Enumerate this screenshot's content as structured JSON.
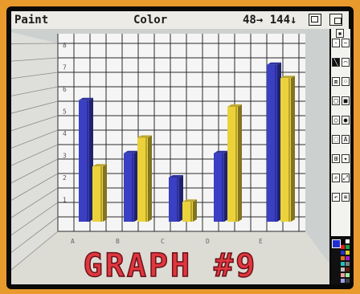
{
  "menubar": {
    "paint_label": "Paint",
    "color_label": "Color",
    "x_coord": "48",
    "x_arrow": "→",
    "y_coord": "144",
    "y_arrow": "↓"
  },
  "chart_data": {
    "type": "bar",
    "title": "GRAPH #9",
    "categories": [
      "A",
      "B",
      "C",
      "D",
      "E"
    ],
    "y_tick_labels": [
      "1",
      "2",
      "3",
      "4",
      "5",
      "6",
      "7",
      "8"
    ],
    "series": [
      {
        "color": "#3a3fc4",
        "values": [
          5.5,
          3.1,
          2.0,
          3.1,
          7.1
        ]
      },
      {
        "color": "#ecd23a",
        "values": [
          2.5,
          3.8,
          0.9,
          5.2,
          6.5
        ]
      }
    ],
    "ylim": [
      0,
      8
    ],
    "grid": true
  },
  "colors": {
    "title_fill": "#e0373f",
    "title_outline": "#6a1018",
    "floor": "#dcdcd4",
    "grid_back": "#f5f5f5"
  },
  "tools": [
    {
      "name": "dotted-freehand",
      "glyph": "·"
    },
    {
      "name": "continuous-freehand",
      "glyph": "~"
    },
    {
      "name": "straight-line",
      "glyph": "╲"
    },
    {
      "name": "curve",
      "glyph": "⌒"
    },
    {
      "name": "fill",
      "glyph": "⧈"
    },
    {
      "name": "airbrush",
      "glyph": "⁘"
    },
    {
      "name": "rectangle",
      "glyph": "□"
    },
    {
      "name": "filled-rectangle",
      "glyph": "■"
    },
    {
      "name": "circle",
      "glyph": "○"
    },
    {
      "name": "filled-circle",
      "glyph": "●"
    },
    {
      "name": "brush-select",
      "glyph": "⬚"
    },
    {
      "name": "text",
      "glyph": "A"
    },
    {
      "name": "grid",
      "glyph": "⊞"
    },
    {
      "name": "symmetry",
      "glyph": "✦"
    },
    {
      "name": "magnify",
      "glyph": "⌕"
    },
    {
      "name": "zoom",
      "glyph": "⤢"
    },
    {
      "name": "undo",
      "glyph": "↶"
    },
    {
      "name": "clear",
      "glyph": "⌧"
    }
  ],
  "palette": [
    "#000000",
    "#ffffff",
    "#e02020",
    "#20a040",
    "#2030d0",
    "#e0d020",
    "#e07020",
    "#a020c0",
    "#20c0c0",
    "#808080",
    "#c0c0c0",
    "#602010",
    "#f0a0a0",
    "#a0f0a0",
    "#a0a0f0",
    "#404040"
  ]
}
